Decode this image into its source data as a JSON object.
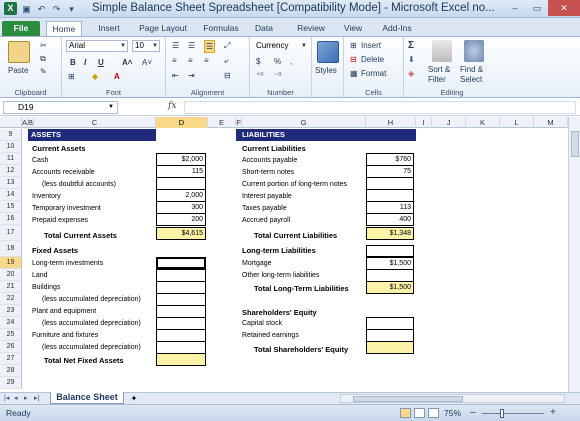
{
  "window": {
    "title": "Simple Balance Sheet Spreadsheet  [Compatibility Mode]  -  Microsoft Excel no...",
    "min": "–",
    "max": "▭",
    "close": "✕"
  },
  "tabs": [
    "File",
    "Home",
    "Insert",
    "Page Layout",
    "Formulas",
    "Data",
    "Review",
    "View",
    "Add-Ins"
  ],
  "ribbon": {
    "paste": "Paste",
    "clipboard": "Clipboard",
    "font_name": "Arial",
    "font_size": "10",
    "font": "Font",
    "alignment": "Alignment",
    "number_format": "Currency",
    "number": "Number",
    "styles": "Styles",
    "insert": "Insert",
    "delete": "Delete",
    "format": "Format",
    "cells": "Cells",
    "sort_filter": "Sort &",
    "sort_filter2": "Filter",
    "find_select": "Find &",
    "find_select2": "Select",
    "editing": "Editing",
    "bold": "B",
    "italic": "I",
    "underline": "U",
    "dollar": "$",
    "percent": "%",
    "comma": ","
  },
  "formula_bar": {
    "name_box": "D19",
    "fx": "fx",
    "value": ""
  },
  "columns": [
    "A",
    "B",
    "C",
    "D",
    "E",
    "F",
    "G",
    "H",
    "I",
    "J",
    "K",
    "L",
    "M"
  ],
  "rows": [
    "9",
    "10",
    "11",
    "12",
    "13",
    "14",
    "15",
    "16",
    "17",
    "18",
    "19",
    "20",
    "21",
    "22",
    "23",
    "24",
    "25",
    "26",
    "27",
    "28",
    "29"
  ],
  "assets": {
    "header": "ASSETS",
    "current": "Current Assets",
    "cash": "Cash",
    "cash_v": "$2,000",
    "ar": "Accounts receivable",
    "ar_v": "115",
    "doubtful": "(less doubtful accounts)",
    "inventory": "Inventory",
    "inventory_v": "2,000",
    "temp": "Temporary investment",
    "temp_v": "300",
    "prepaid": "Prepaid expenses",
    "prepaid_v": "200",
    "total_current": "Total Current Assets",
    "total_current_v": "$4,615",
    "fixed": "Fixed Assets",
    "lti": "Long-term investments",
    "land": "Land",
    "buildings": "Buildings",
    "dep1": "(less accumulated depreciation)",
    "plant": "Plant and equipment",
    "dep2": "(less accumulated depreciation)",
    "furniture": "Furniture and fixtures",
    "dep3": "(less accumulated depreciation)",
    "total_fixed": "Total Net Fixed Assets"
  },
  "liabilities": {
    "header": "LIABILITIES",
    "current": "Current Liabilities",
    "ap": "Accounts payable",
    "ap_v": "$760",
    "stn": "Short-term notes",
    "stn_v": "75",
    "cpltn": "Current portion of long-term notes",
    "interest": "Interest payable",
    "taxes": "Taxes payable",
    "taxes_v": "113",
    "accrued": "Accrued payroll",
    "accrued_v": "400",
    "total_current": "Total Current Liabilities",
    "total_current_v": "$1,348",
    "lt": "Long-term Liabilities",
    "mortgage": "Mortgage",
    "mortgage_v": "$1,500",
    "other": "Other long-term liabilities",
    "total_lt": "Total Long-Term Liabilities",
    "total_lt_v": "$1,500",
    "equity": "Shareholders' Equity",
    "capital": "Capital stock",
    "retained": "Retained earnings",
    "total_equity": "Total Shareholders' Equity"
  },
  "sheet_tab": "Balance Sheet",
  "status": {
    "ready": "Ready",
    "zoom": "75%",
    "minus": "–",
    "plus": "+"
  },
  "colors": {
    "header_bar": "#1f2b7a",
    "highlight": "#fdf3a8",
    "file_tab": "#2a8d3e"
  }
}
